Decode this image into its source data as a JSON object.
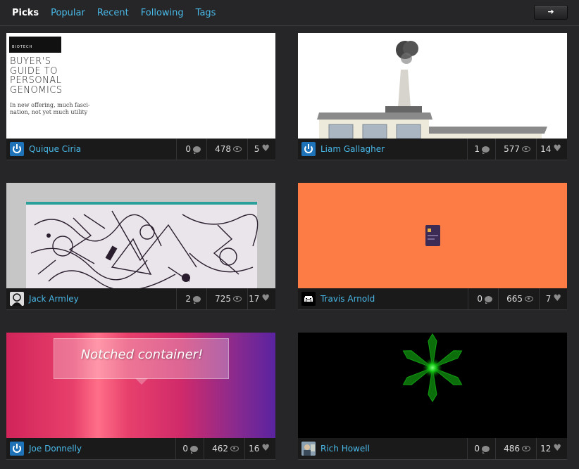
{
  "nav": {
    "tabs": [
      {
        "label": "Picks",
        "active": true
      },
      {
        "label": "Popular"
      },
      {
        "label": "Recent"
      },
      {
        "label": "Following"
      },
      {
        "label": "Tags"
      }
    ],
    "forward_button": "➜"
  },
  "cards": [
    {
      "author": "Quique Ciria",
      "avatar_icon": "power-icon",
      "comments": "0",
      "views": "478",
      "likes": "5",
      "thumb": {
        "tag": "BIOTECH",
        "headline": "BUYER'S\nGUIDE TO\nPERSONAL\nGENOMICS",
        "dek": "In new offering, much fasci-\nnation, not yet much utility"
      }
    },
    {
      "author": "Liam Gallagher",
      "avatar_icon": "power-icon",
      "comments": "1",
      "views": "577",
      "likes": "14"
    },
    {
      "author": "Jack Armley",
      "avatar_icon": "sketch-portrait-avatar",
      "comments": "2",
      "views": "725",
      "likes": "17"
    },
    {
      "author": "Travis Arnold",
      "avatar_icon": "space-invader-avatar",
      "comments": "0",
      "views": "665",
      "likes": "7"
    },
    {
      "author": "Joe Donnelly",
      "avatar_icon": "power-icon",
      "comments": "0",
      "views": "462",
      "likes": "16",
      "thumb": {
        "notch_text": "Notched container!"
      }
    },
    {
      "author": "Rich Howell",
      "avatar_icon": "photo-avatar",
      "comments": "0",
      "views": "486",
      "likes": "12"
    }
  ],
  "colors": {
    "background": "#262628",
    "link": "#49b8e6",
    "meta_bar": "#1a1a1b",
    "orange_thumb": "#fd7b45"
  }
}
